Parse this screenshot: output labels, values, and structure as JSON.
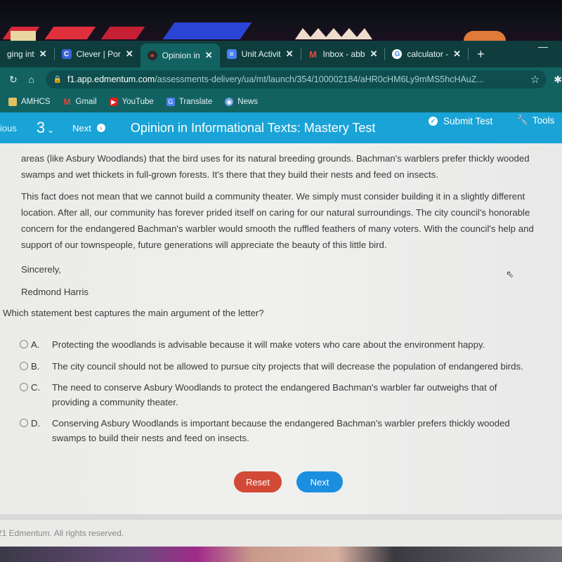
{
  "browser": {
    "tabs": [
      {
        "title": "ging int",
        "favicon": "unknown",
        "active": false
      },
      {
        "title": "Clever | Por",
        "favicon": "clever-icon",
        "active": false
      },
      {
        "title": "Opinion in",
        "favicon": "edmentum-icon",
        "active": true
      },
      {
        "title": "Unit Activit",
        "favicon": "docs-icon",
        "active": false
      },
      {
        "title": "Inbox - abb",
        "favicon": "gmail-icon",
        "active": false
      },
      {
        "title": "calculator -",
        "favicon": "google-icon",
        "active": false
      }
    ],
    "close_glyph": "✕",
    "new_tab_glyph": "+",
    "url": {
      "host": "f1.app.edmentum.com",
      "path": "/assessments-delivery/ua/mt/launch/354/100002184/aHR0cHM6Ly9mMS5hcHAuZ..."
    },
    "bookmarks": [
      {
        "label": "AMHCS",
        "icon": "folder-icon"
      },
      {
        "label": "Gmail",
        "icon": "gmail-icon"
      },
      {
        "label": "YouTube",
        "icon": "youtube-icon"
      },
      {
        "label": "Translate",
        "icon": "translate-icon"
      },
      {
        "label": "News",
        "icon": "news-icon"
      }
    ]
  },
  "toolbar": {
    "previous_label": "ious",
    "question_number": "3",
    "next_label": "Next",
    "title": "Opinion in Informational Texts: Mastery Test",
    "submit_label": "Submit Test",
    "tools_label": "Tools"
  },
  "passage": {
    "p1_lines": [
      "areas (like Asbury Woodlands) that the bird uses for its natural breeding grounds. Bachman's warblers prefer thickly wooded",
      "swamps and wet thickets in full-grown forests. It's there that they build their nests and feed on insects."
    ],
    "p2_lines": [
      "This fact does not mean that we cannot build a community theater. We simply must consider building it in a slightly different",
      "location. After all, our community has forever prided itself on caring for our natural surroundings. The city council's honorable",
      "concern for the endangered Bachman's warbler would smooth the ruffled feathers of many voters. With the council's help and",
      "support of our townspeople, future generations will appreciate the beauty of this little bird."
    ],
    "closing": "Sincerely,",
    "signature": "Redmond Harris"
  },
  "question": {
    "prompt": "Which statement best captures the main argument of the letter?",
    "options": [
      {
        "letter": "A.",
        "text": "Protecting the woodlands is advisable because it will make voters who care about the environment happy.",
        "selected": false
      },
      {
        "letter": "B.",
        "text": "The city council should not be allowed to pursue city projects that will decrease the population of endangered birds.",
        "selected": false
      },
      {
        "letter": "C.",
        "text": "The need to conserve Asbury Woodlands to protect the endangered Bachman's warbler far outweighs that of providing a community theater.",
        "selected": false
      },
      {
        "letter": "D.",
        "text": "Conserving Asbury Woodlands is important because the endangered Bachman's warbler prefers thickly wooded swamps to build their nests and feed on insects.",
        "selected": false
      }
    ]
  },
  "actions": {
    "reset_label": "Reset",
    "next_label": "Next"
  },
  "footer": {
    "copyright": "21 Edmentum. All rights reserved."
  },
  "colors": {
    "toolbar_bg": "#1aa3d6",
    "reset_button": "#d24a36",
    "next_button": "#1a8fe0",
    "browser_chrome": "#126262"
  }
}
